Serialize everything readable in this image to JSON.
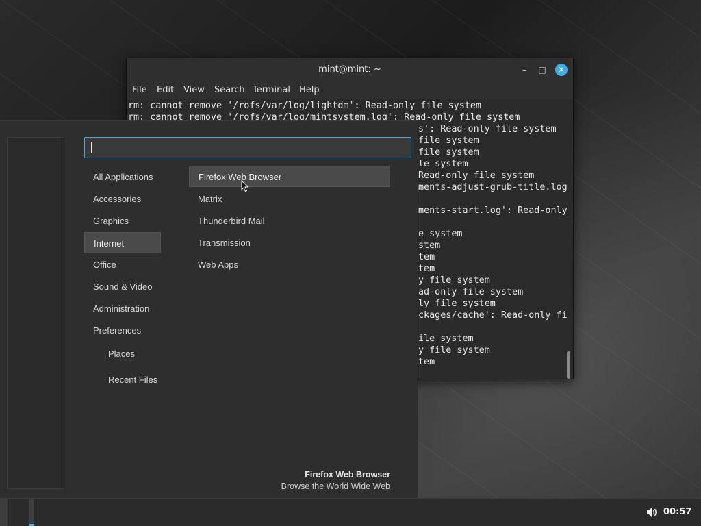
{
  "terminal": {
    "title": "mint@mint: ~",
    "window_buttons": {
      "minimize": "–",
      "maximize": "□",
      "close": "✕"
    },
    "menu": [
      "File",
      "Edit",
      "View",
      "Search",
      "Terminal",
      "Help"
    ],
    "visible_full_lines": [
      "rm: cannot remove '/rofs/var/log/lightdm': Read-only file system",
      "rm: cannot remove '/rofs/var/log/mintsystem.log': Read-only file system"
    ],
    "partial_lines": [
      "s': Read-only file system",
      "file system",
      "file system",
      "le system",
      "Read-only file system",
      "ments-adjust-grub-title.log",
      "",
      "ments-start.log': Read-only",
      "",
      "e system",
      "stem",
      "tem",
      "tem",
      "y file system",
      "ad-only file system",
      "ly file system",
      "ckages/cache': Read-only fi",
      "",
      "ile system",
      "y file system",
      "tem"
    ]
  },
  "menu_panel": {
    "search": {
      "value": "",
      "placeholder": ""
    },
    "categories": [
      {
        "label": "All Applications",
        "selected": false
      },
      {
        "label": "Accessories",
        "selected": false
      },
      {
        "label": "Graphics",
        "selected": false
      },
      {
        "label": "Internet",
        "selected": true
      },
      {
        "label": "Office",
        "selected": false
      },
      {
        "label": "Sound & Video",
        "selected": false
      },
      {
        "label": "Administration",
        "selected": false
      },
      {
        "label": "Preferences",
        "selected": false
      }
    ],
    "places": [
      "Places",
      "Recent Files"
    ],
    "apps": [
      {
        "label": "Firefox Web Browser",
        "hover": true
      },
      {
        "label": "Matrix",
        "hover": false
      },
      {
        "label": "Thunderbird Mail",
        "hover": false
      },
      {
        "label": "Transmission",
        "hover": false
      },
      {
        "label": "Web Apps",
        "hover": false
      }
    ],
    "description": {
      "title": "Firefox Web Browser",
      "subtitle": "Browse the World Wide Web"
    }
  },
  "panel": {
    "clock": "00:57",
    "volume_icon": "speaker-icon",
    "accent_color": "#3daee9"
  }
}
